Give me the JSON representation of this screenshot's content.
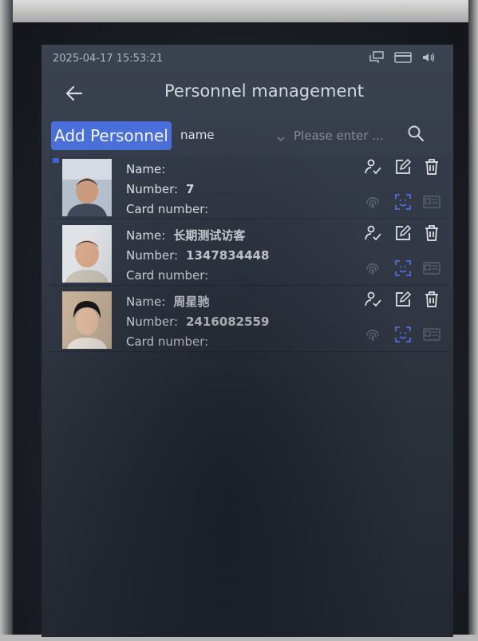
{
  "status_bar": {
    "datetime": "2025-04-17 15:53:21",
    "icons": [
      "network-icon",
      "card-reader-icon",
      "speaker-icon"
    ]
  },
  "header": {
    "title": "Personnel management",
    "back_icon": "back-arrow-icon"
  },
  "toolbar": {
    "add_label": "Add Personnel",
    "field_selected": "name",
    "search_placeholder": "Please enter ...",
    "search_icon": "search-icon"
  },
  "labels": {
    "name": "Name:",
    "number": "Number:",
    "card": "Card number:"
  },
  "people": [
    {
      "name": "",
      "number": "7",
      "card": ""
    },
    {
      "name": "长期测试访客",
      "number": "1347834448",
      "card": ""
    },
    {
      "name": "周星驰",
      "number": "2416082559",
      "card": ""
    }
  ],
  "colors": {
    "accent": "#4b6fd9",
    "face_active": "#4f6fe0",
    "icon_muted": "#5f6774",
    "text": "#e7e9ee"
  }
}
